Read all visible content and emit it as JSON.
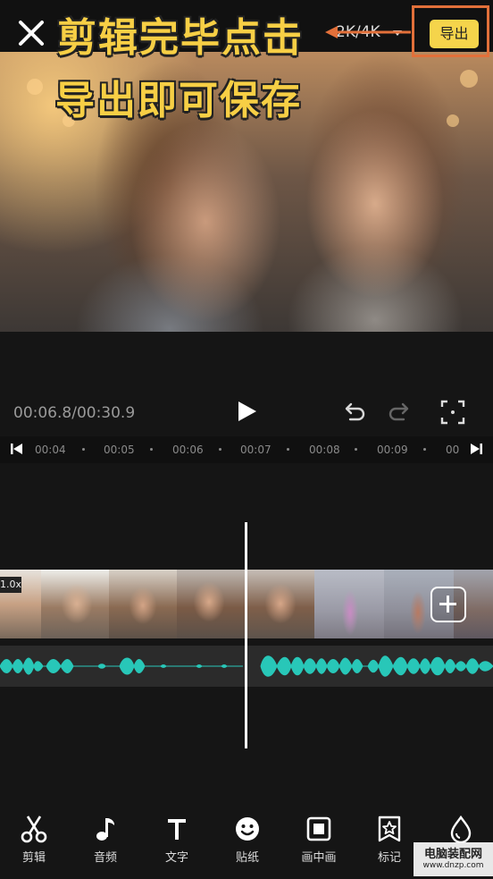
{
  "header": {
    "resolution_label": "2K/4K",
    "export_label": "导出"
  },
  "overlay": {
    "caption_line1": "剪辑完毕点击",
    "caption_line2": "导出即可保存"
  },
  "transport": {
    "timecode": "00:06.8/00:30.9"
  },
  "ruler": {
    "ticks": [
      "00:04",
      "00:05",
      "00:06",
      "00:07",
      "00:08",
      "00:09",
      "00"
    ]
  },
  "timeline": {
    "speed_badge": "1.0x"
  },
  "toolbar": {
    "items": [
      {
        "label": "剪辑",
        "icon": "scissors-icon"
      },
      {
        "label": "音频",
        "icon": "music-note-icon"
      },
      {
        "label": "文字",
        "icon": "text-icon"
      },
      {
        "label": "贴纸",
        "icon": "sticker-icon"
      },
      {
        "label": "画中画",
        "icon": "picture-in-picture-icon"
      },
      {
        "label": "标记",
        "icon": "bookmark-star-icon"
      },
      {
        "label": "",
        "icon": "drop-icon"
      }
    ]
  },
  "watermark": {
    "line1": "电脑装配网",
    "line2": "www.dnzp.com"
  },
  "colors": {
    "accent_yellow": "#f5d44b",
    "highlight_frame": "#e2703a",
    "waveform": "#28c7b8"
  }
}
